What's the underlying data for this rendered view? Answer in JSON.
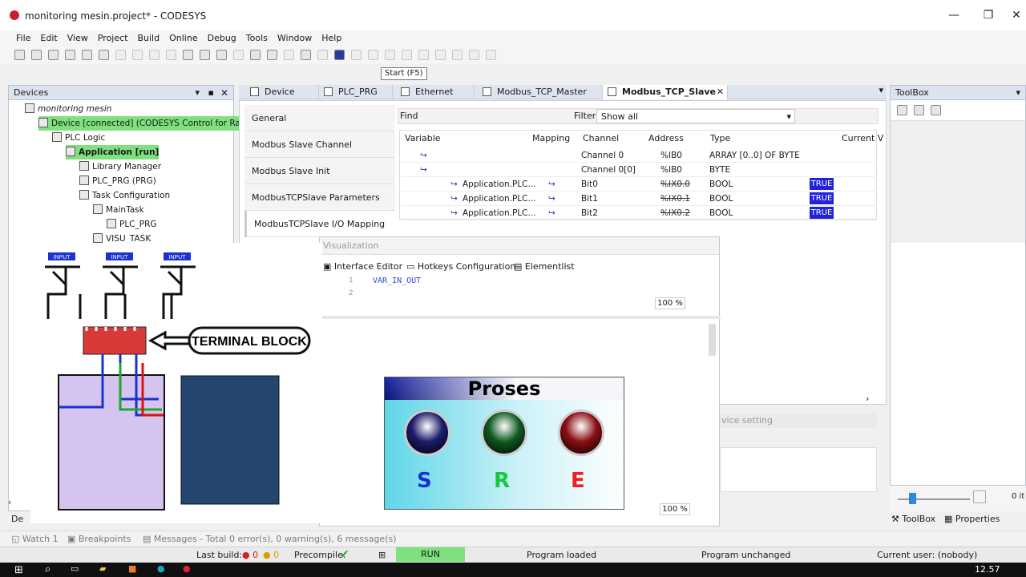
{
  "window": {
    "title": "monitoring mesin.project* - CODESYS",
    "minimize": "—",
    "restore": "❐",
    "close": "✕"
  },
  "menu": [
    "File",
    "Edit",
    "View",
    "Project",
    "Build",
    "Online",
    "Debug",
    "Tools",
    "Window",
    "Help"
  ],
  "tooltip": "Start (F5)",
  "devices": {
    "title": "Devices",
    "tree": [
      {
        "label": "monitoring mesin",
        "level": 0,
        "italic": true,
        "highlight": false
      },
      {
        "label": "Device [connected] (CODESYS Control for Ras",
        "level": 1,
        "italic": false,
        "highlight": true
      },
      {
        "label": "PLC Logic",
        "level": 2,
        "italic": false,
        "highlight": false
      },
      {
        "label": "Application [run]",
        "level": 3,
        "italic": false,
        "highlight": true,
        "bold": true
      },
      {
        "label": "Library Manager",
        "level": 4,
        "italic": false,
        "highlight": false
      },
      {
        "label": "PLC_PRG (PRG)",
        "level": 4,
        "italic": false,
        "highlight": false
      },
      {
        "label": "Task Configuration",
        "level": 4,
        "italic": false,
        "highlight": false
      },
      {
        "label": "MainTask",
        "level": 5,
        "italic": false,
        "highlight": false
      },
      {
        "label": "PLC_PRG",
        "level": 6,
        "italic": false,
        "highlight": false
      },
      {
        "label": "VISU_TASK",
        "level": 5,
        "italic": false,
        "highlight": false
      }
    ]
  },
  "editor_tabs": [
    {
      "label": "Device",
      "active": false
    },
    {
      "label": "PLC_PRG",
      "active": false
    },
    {
      "label": "Ethernet",
      "active": false
    },
    {
      "label": "Modbus_TCP_Master",
      "active": false
    },
    {
      "label": "Modbus_TCP_Slave",
      "active": true
    }
  ],
  "slave_nav": [
    "General",
    "Modbus Slave Channel",
    "Modbus Slave Init",
    "ModbusTCPSlave Parameters",
    "ModbusTCPSlave I/O Mapping"
  ],
  "find": {
    "label": "Find",
    "filter_label": "Filter",
    "filter_value": "Show all"
  },
  "mapping_table": {
    "columns": [
      "Variable",
      "Mapping",
      "Channel",
      "Address",
      "Type",
      "Current V"
    ],
    "rows": [
      {
        "variable": "",
        "mapping": "",
        "channel": "Channel 0",
        "address": "%IB0",
        "type": "ARRAY [0..0] OF BYTE",
        "current": "",
        "strike": false
      },
      {
        "variable": "",
        "mapping": "",
        "channel": "Channel 0[0]",
        "address": "%IB0",
        "type": "BYTE",
        "current": "",
        "strike": false
      },
      {
        "variable": "Application.PLC...",
        "mapping": "map",
        "channel": "Bit0",
        "address": "%IX0.0",
        "type": "BOOL",
        "current": "TRUE",
        "strike": true
      },
      {
        "variable": "Application.PLC...",
        "mapping": "map",
        "channel": "Bit1",
        "address": "%IX0.1",
        "type": "BOOL",
        "current": "TRUE",
        "strike": true
      },
      {
        "variable": "Application.PLC...",
        "mapping": "map",
        "channel": "Bit2",
        "address": "%IX0.2",
        "type": "BOOL",
        "current": "TRUE",
        "strike": true
      }
    ]
  },
  "visualization": {
    "title": "Visualization",
    "tabs": [
      "Interface Editor",
      "Hotkeys Configuration",
      "Elementlist"
    ],
    "code_lines": [
      "1",
      "2"
    ],
    "code": "VAR_IN_OUT",
    "zoom_top": "100 %",
    "zoom_bottom": "100 %",
    "panel_title": "Proses",
    "indicators": [
      {
        "letter": "S",
        "color": "#1530d8",
        "bulb": "#1c1c6a"
      },
      {
        "letter": "R",
        "color": "#19c83c",
        "bulb": "#0f5a22"
      },
      {
        "letter": "E",
        "color": "#ee2020",
        "bulb": "#8a0f14"
      }
    ]
  },
  "overlay": {
    "terminal_label": "TERMINAL BLOCK",
    "input_labels": [
      "INPUT",
      "INPUT",
      "INPUT"
    ]
  },
  "toolbox": {
    "title": "ToolBox",
    "zoom": "0 it",
    "tab_toolbox": "ToolBox",
    "tab_properties": "Properties"
  },
  "device_setting": "vice setting",
  "bottom_tabs": [
    "Watch 1",
    "Breakpoints",
    "Messages - Total 0 error(s), 0 warning(s), 6 message(s)"
  ],
  "devices_tab": "De",
  "status": {
    "last_build": "Last build:",
    "errors": "0",
    "warnings": "0",
    "precompile": "Precompile:",
    "run": "RUN",
    "program": "Program loaded",
    "changes": "Program unchanged",
    "user": "Current user: (nobody)"
  },
  "taskbar": {
    "time": "12.57"
  }
}
